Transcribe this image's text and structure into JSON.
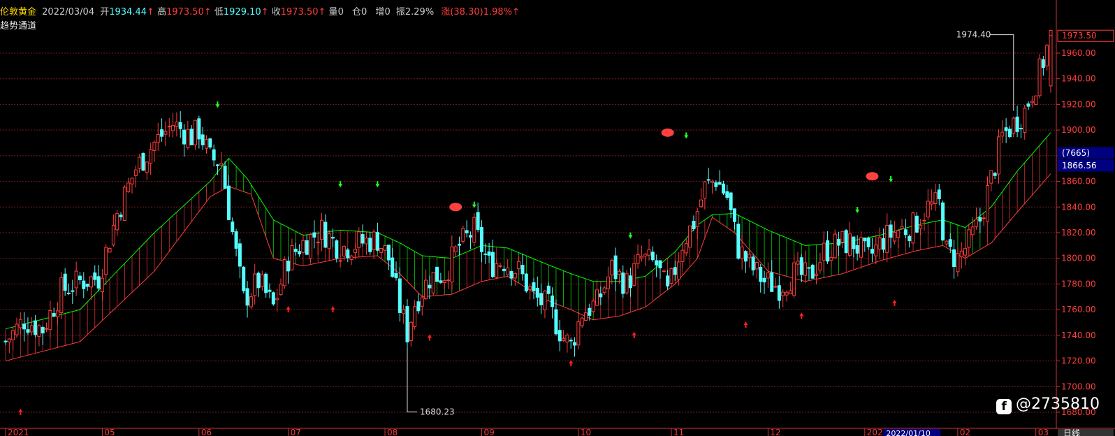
{
  "header": {
    "name": "伦敦黄金",
    "date": "2022/03/04",
    "open_label": "开",
    "open": "1934.44",
    "high_label": "高",
    "high": "1973.50",
    "low_label": "低",
    "low": "1929.10",
    "close_label": "收",
    "close": "1973.50",
    "vol_label": "量",
    "vol": "0",
    "oi_label": "仓",
    "oi": "0",
    "inc_label": "增",
    "inc": "0",
    "amp_label": "振",
    "amp": "2.29%",
    "chg_label": "涨",
    "chg": "(38.30)1.98%",
    "arrow": "↑"
  },
  "indicator_name": "趋势通道",
  "right_axis": {
    "last_price_box": "1973.50",
    "count_box": "(7665)",
    "cursor_price_box": "1866.56",
    "period_label": "日线"
  },
  "watermark": {
    "icon": "f",
    "text": "@2735810"
  },
  "annotations": {
    "high_label": "1974.40",
    "low_label": "1680.23",
    "date_box": "2022/01/10"
  },
  "colors": {
    "up": "#ff3c3c",
    "down": "#54ffff",
    "band_up": "#ff3c3c",
    "band_down": "#00ff00",
    "grid": "#7a1a1a",
    "buy": "#ff2020",
    "sell": "#20ff20"
  },
  "chart_data": {
    "type": "candlestick",
    "title": "伦敦黄金",
    "subtitle": "趋势通道",
    "ylim": [
      1680,
      1980
    ],
    "yticks": [
      1680,
      1700,
      1720,
      1740,
      1760,
      1780,
      1800,
      1820,
      1840,
      1860,
      1880,
      1900,
      1920,
      1940,
      1960
    ],
    "ytick_labels": [
      "1680.00",
      "1700.00",
      "1720.00",
      "1740.00",
      "1760.00",
      "1780.00",
      "1800.00",
      "1820.00",
      "1840.00",
      "1860.00",
      "1880.00",
      "1900.00",
      "1920.00",
      "1940.00",
      "1960.00"
    ],
    "x_month_labels": [
      {
        "label": "2021",
        "index": 0
      },
      {
        "label": "05",
        "index": 26
      },
      {
        "label": "06",
        "index": 52
      },
      {
        "label": "07",
        "index": 76
      },
      {
        "label": "08",
        "index": 102
      },
      {
        "label": "09",
        "index": 128
      },
      {
        "label": "10",
        "index": 154
      },
      {
        "label": "11",
        "index": 179
      },
      {
        "label": "12",
        "index": 205
      },
      {
        "label": "2022",
        "index": 231
      },
      {
        "label": "02",
        "index": 256
      },
      {
        "label": "03",
        "index": 277
      }
    ],
    "n_bars": 282,
    "close_anchors": [
      [
        0,
        1735
      ],
      [
        5,
        1752
      ],
      [
        10,
        1745
      ],
      [
        15,
        1775
      ],
      [
        20,
        1782
      ],
      [
        25,
        1785
      ],
      [
        30,
        1835
      ],
      [
        35,
        1870
      ],
      [
        40,
        1890
      ],
      [
        45,
        1905
      ],
      [
        50,
        1895
      ],
      [
        52,
        1900
      ],
      [
        55,
        1878
      ],
      [
        58,
        1875
      ],
      [
        61,
        1820
      ],
      [
        64,
        1768
      ],
      [
        68,
        1782
      ],
      [
        72,
        1762
      ],
      [
        76,
        1800
      ],
      [
        80,
        1812
      ],
      [
        85,
        1822
      ],
      [
        90,
        1808
      ],
      [
        95,
        1812
      ],
      [
        100,
        1815
      ],
      [
        103,
        1800
      ],
      [
        106,
        1762
      ],
      [
        108,
        1742
      ],
      [
        110,
        1765
      ],
      [
        114,
        1785
      ],
      [
        118,
        1788
      ],
      [
        122,
        1810
      ],
      [
        126,
        1822
      ],
      [
        130,
        1795
      ],
      [
        134,
        1798
      ],
      [
        138,
        1790
      ],
      [
        142,
        1770
      ],
      [
        146,
        1762
      ],
      [
        150,
        1738
      ],
      [
        152,
        1732
      ],
      [
        155,
        1758
      ],
      [
        159,
        1765
      ],
      [
        163,
        1792
      ],
      [
        167,
        1780
      ],
      [
        171,
        1800
      ],
      [
        175,
        1795
      ],
      [
        178,
        1772
      ],
      [
        182,
        1812
      ],
      [
        185,
        1828
      ],
      [
        188,
        1855
      ],
      [
        191,
        1862
      ],
      [
        194,
        1848
      ],
      [
        197,
        1808
      ],
      [
        200,
        1795
      ],
      [
        204,
        1782
      ],
      [
        208,
        1778
      ],
      [
        212,
        1788
      ],
      [
        216,
        1785
      ],
      [
        220,
        1805
      ],
      [
        224,
        1812
      ],
      [
        228,
        1812
      ],
      [
        232,
        1800
      ],
      [
        236,
        1815
      ],
      [
        240,
        1822
      ],
      [
        244,
        1825
      ],
      [
        248,
        1840
      ],
      [
        251,
        1842
      ],
      [
        253,
        1805
      ],
      [
        256,
        1800
      ],
      [
        259,
        1812
      ],
      [
        262,
        1830
      ],
      [
        265,
        1862
      ],
      [
        268,
        1895
      ],
      [
        271,
        1905
      ],
      [
        274,
        1915
      ],
      [
        276,
        1930
      ],
      [
        278,
        1945
      ],
      [
        281,
        1973
      ]
    ],
    "channel_upper_anchors": [
      [
        0,
        1745
      ],
      [
        20,
        1760
      ],
      [
        40,
        1820
      ],
      [
        55,
        1860
      ],
      [
        60,
        1878
      ],
      [
        65,
        1862
      ],
      [
        72,
        1830
      ],
      [
        80,
        1818
      ],
      [
        90,
        1822
      ],
      [
        100,
        1820
      ],
      [
        106,
        1812
      ],
      [
        112,
        1802
      ],
      [
        120,
        1800
      ],
      [
        128,
        1810
      ],
      [
        135,
        1808
      ],
      [
        145,
        1796
      ],
      [
        152,
        1788
      ],
      [
        158,
        1782
      ],
      [
        165,
        1782
      ],
      [
        172,
        1786
      ],
      [
        180,
        1805
      ],
      [
        186,
        1826
      ],
      [
        190,
        1834
      ],
      [
        196,
        1835
      ],
      [
        205,
        1822
      ],
      [
        215,
        1810
      ],
      [
        225,
        1812
      ],
      [
        235,
        1818
      ],
      [
        245,
        1826
      ],
      [
        252,
        1830
      ],
      [
        258,
        1824
      ],
      [
        265,
        1840
      ],
      [
        272,
        1868
      ],
      [
        281,
        1898
      ]
    ],
    "channel_lower_anchors": [
      [
        0,
        1720
      ],
      [
        20,
        1735
      ],
      [
        40,
        1790
      ],
      [
        55,
        1848
      ],
      [
        60,
        1856
      ],
      [
        66,
        1850
      ],
      [
        72,
        1800
      ],
      [
        80,
        1794
      ],
      [
        90,
        1800
      ],
      [
        100,
        1802
      ],
      [
        106,
        1788
      ],
      [
        112,
        1770
      ],
      [
        120,
        1772
      ],
      [
        128,
        1782
      ],
      [
        135,
        1786
      ],
      [
        145,
        1768
      ],
      [
        152,
        1760
      ],
      [
        158,
        1752
      ],
      [
        165,
        1755
      ],
      [
        172,
        1762
      ],
      [
        180,
        1780
      ],
      [
        186,
        1800
      ],
      [
        190,
        1832
      ],
      [
        196,
        1820
      ],
      [
        205,
        1790
      ],
      [
        215,
        1782
      ],
      [
        225,
        1788
      ],
      [
        235,
        1798
      ],
      [
        245,
        1806
      ],
      [
        252,
        1810
      ],
      [
        258,
        1800
      ],
      [
        265,
        1812
      ],
      [
        272,
        1836
      ],
      [
        281,
        1866
      ]
    ],
    "buy_signals_idx": [
      4,
      76,
      88,
      114,
      152,
      169,
      199,
      214,
      239
    ],
    "sell_signals_idx": [
      57,
      90,
      100,
      126,
      168,
      183,
      229,
      238
    ],
    "buy_signal_prices": [
      1680,
      1760,
      1760,
      1738,
      1718,
      1740,
      1748,
      1755,
      1765
    ],
    "sell_signal_prices": [
      1920,
      1858,
      1858,
      1842,
      1818,
      1896,
      1838,
      1862
    ],
    "circle_markers": [
      {
        "index": 121,
        "price": 1840
      },
      {
        "index": 178,
        "price": 1898
      },
      {
        "index": 233,
        "price": 1864
      }
    ],
    "annotated_points": [
      {
        "label": "1974.40",
        "index": 259,
        "price": 1974.4
      },
      {
        "label": "1680.23",
        "index": 102,
        "price": 1680.23
      }
    ]
  }
}
